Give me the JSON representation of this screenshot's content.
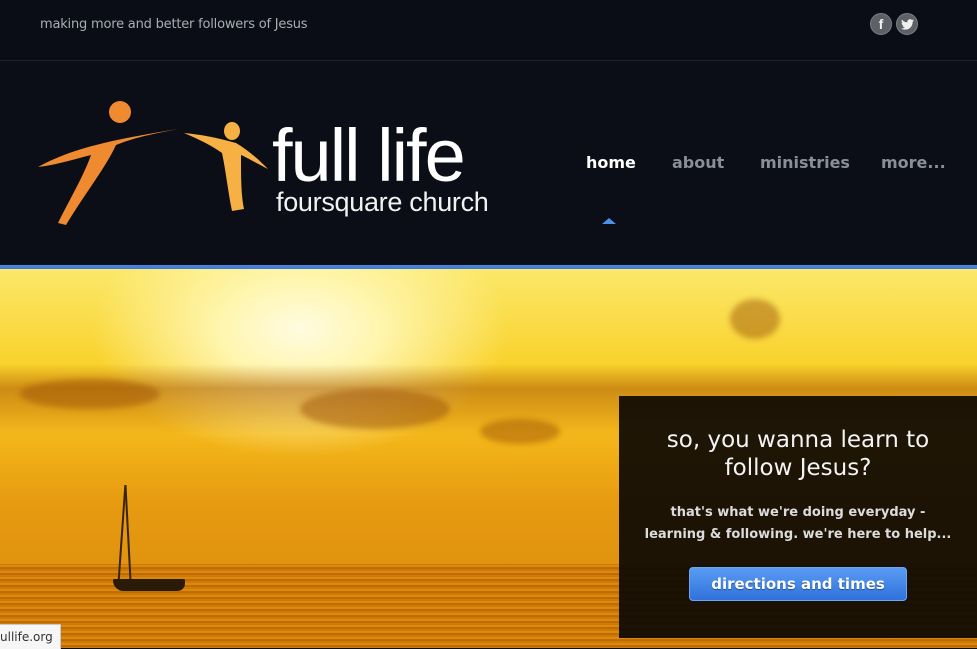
{
  "topbar": {
    "tagline": "making more and better followers of Jesus",
    "social": [
      {
        "name": "facebook",
        "glyph": "f"
      },
      {
        "name": "twitter",
        "glyph": "🐦"
      }
    ]
  },
  "brand": {
    "name": "full life",
    "subtitle": "foursquare church",
    "colors": {
      "figure_left": "#f08a30",
      "figure_right": "#f7b043"
    }
  },
  "nav": {
    "items": [
      {
        "label": "home",
        "active": true
      },
      {
        "label": "about",
        "active": false
      },
      {
        "label": "ministries",
        "active": false
      },
      {
        "label": "more...",
        "active": false
      }
    ],
    "accent": "#4d8fe8"
  },
  "hero": {
    "heading": "so, you wanna learn to follow Jesus?",
    "subtext_line1": "that's what we're doing everyday -",
    "subtext_line2": "learning & following. we're here to help...",
    "button_label": "directions and times"
  },
  "status_bar": {
    "url_text": "ullife.org"
  }
}
